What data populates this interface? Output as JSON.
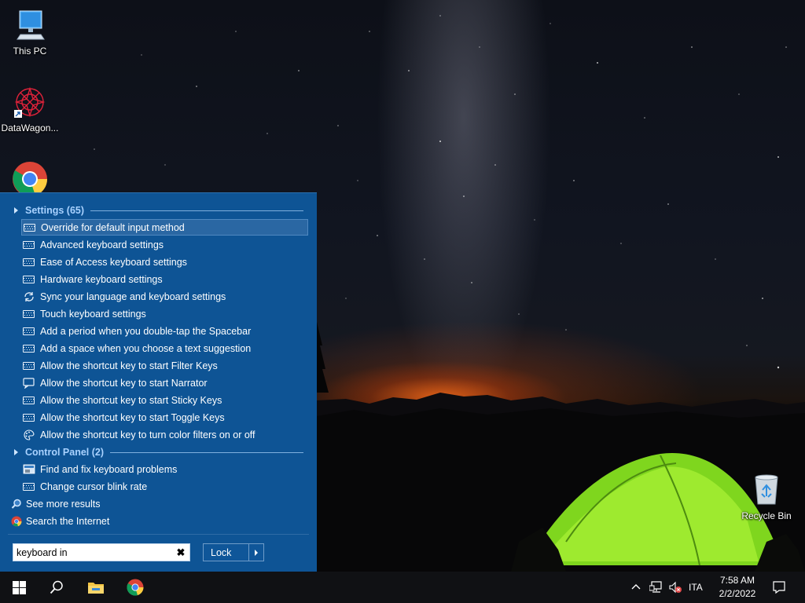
{
  "desktop": {
    "icons": [
      {
        "label": "This PC"
      },
      {
        "label": "DataWagon..."
      },
      {
        "label": "Google Chrome"
      },
      {
        "label": "Recycle Bin"
      }
    ]
  },
  "search_panel": {
    "groups": [
      {
        "header": "Settings (65)"
      },
      {
        "header": "Control Panel (2)"
      }
    ],
    "settings_results": [
      {
        "label": "Override for default input method",
        "icon": "keyboard-icon",
        "selected": true
      },
      {
        "label": "Advanced keyboard settings",
        "icon": "keyboard-icon"
      },
      {
        "label": "Ease of Access keyboard settings",
        "icon": "keyboard-icon"
      },
      {
        "label": "Hardware keyboard settings",
        "icon": "keyboard-icon"
      },
      {
        "label": "Sync your language and keyboard settings",
        "icon": "sync-icon"
      },
      {
        "label": "Touch keyboard settings",
        "icon": "keyboard-icon"
      },
      {
        "label": "Add a period when you double-tap the Spacebar",
        "icon": "keyboard-icon"
      },
      {
        "label": "Add a space when you choose a text suggestion",
        "icon": "keyboard-icon"
      },
      {
        "label": "Allow the shortcut key to start Filter Keys",
        "icon": "keyboard-icon"
      },
      {
        "label": "Allow the shortcut key to start Narrator",
        "icon": "narrator-icon"
      },
      {
        "label": "Allow the shortcut key to start Sticky Keys",
        "icon": "keyboard-icon"
      },
      {
        "label": "Allow the shortcut key to start Toggle Keys",
        "icon": "keyboard-icon"
      },
      {
        "label": "Allow the shortcut key to turn color filters on or off",
        "icon": "color-palette-icon"
      }
    ],
    "control_panel_results": [
      {
        "label": "Find and fix keyboard problems",
        "icon": "troubleshoot-icon"
      },
      {
        "label": "Change cursor blink rate",
        "icon": "keyboard-icon"
      }
    ],
    "see_more": "See more results",
    "search_internet": "Search the Internet",
    "search_box": {
      "value": "keyboard in"
    },
    "lock_button": "Lock"
  },
  "taskbar": {
    "language": "ITA",
    "time": "7:58 AM",
    "date": "2/2/2022"
  },
  "colors": {
    "panel_bg": "#0e5495",
    "group_header": "#a9d2ff",
    "selected_bg": "#2a67a3",
    "taskbar_bg": "#101114"
  }
}
